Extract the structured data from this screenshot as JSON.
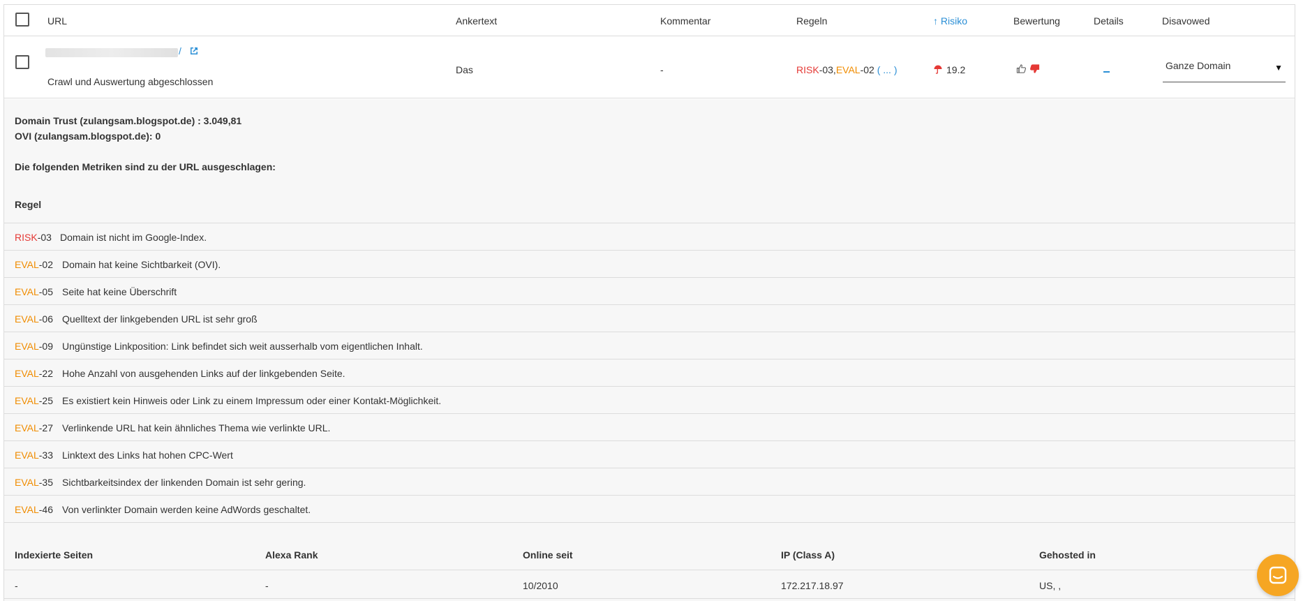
{
  "header": {
    "url": "URL",
    "ankertext": "Ankertext",
    "kommentar": "Kommentar",
    "regeln": "Regeln",
    "risiko": "↑ Risiko",
    "bewertung": "Bewertung",
    "details": "Details",
    "disavowed": "Disavowed"
  },
  "row": {
    "url_tail": "/",
    "status": "Crawl und Auswertung abgeschlossen",
    "ankertext": "Das",
    "kommentar": "-",
    "rules_risk": "RISK",
    "rules_risk_num": "-03,",
    "rules_eval": "EVAL",
    "rules_eval_num": "-02",
    "rules_more": "( ... )",
    "risiko": "19.2",
    "disavowed": "Ganze Domain",
    "disavowed_arrow": "▼"
  },
  "detail": {
    "domain_trust": "Domain Trust (zulangsam.blogspot.de) : 3.049,81",
    "ovi": "OVI (zulangsam.blogspot.de): 0",
    "intro": "Die folgenden Metriken sind zu der URL ausgeschlagen:",
    "regel_heading": "Regel"
  },
  "rules": [
    {
      "prefix": "RISK",
      "num": "-03",
      "desc": "Domain ist nicht im Google-Index."
    },
    {
      "prefix": "EVAL",
      "num": "-02",
      "desc": "Domain hat keine Sichtbarkeit (OVI)."
    },
    {
      "prefix": "EVAL",
      "num": "-05",
      "desc": "Seite hat keine Überschrift"
    },
    {
      "prefix": "EVAL",
      "num": "-06",
      "desc": "Quelltext der linkgebenden URL ist sehr groß"
    },
    {
      "prefix": "EVAL",
      "num": "-09",
      "desc": "Ungünstige Linkposition: Link befindet sich weit ausserhalb vom eigentlichen Inhalt."
    },
    {
      "prefix": "EVAL",
      "num": "-22",
      "desc": "Hohe Anzahl von ausgehenden Links auf der linkgebenden Seite."
    },
    {
      "prefix": "EVAL",
      "num": "-25",
      "desc": "Es existiert kein Hinweis oder Link zu einem Impressum oder einer Kontakt-Möglichkeit."
    },
    {
      "prefix": "EVAL",
      "num": "-27",
      "desc": "Verlinkende URL hat kein ähnliches Thema wie verlinkte URL."
    },
    {
      "prefix": "EVAL",
      "num": "-33",
      "desc": "Linktext des Links hat hohen CPC-Wert"
    },
    {
      "prefix": "EVAL",
      "num": "-35",
      "desc": "Sichtbarkeitsindex der linkenden Domain ist sehr gering."
    },
    {
      "prefix": "EVAL",
      "num": "-46",
      "desc": "Von verlinkter Domain werden keine AdWords geschaltet."
    }
  ],
  "metrics": {
    "headers": [
      "Indexierte Seiten",
      "Alexa Rank",
      "Online seit",
      "IP (Class A)",
      "Gehosted in"
    ],
    "values": [
      "-",
      "-",
      "10/2010",
      "172.217.18.97",
      "US, ,"
    ]
  },
  "colors": {
    "risk": "#e53935",
    "eval": "#f08c00",
    "link": "#2b8fd6",
    "chat": "#f6a623"
  }
}
